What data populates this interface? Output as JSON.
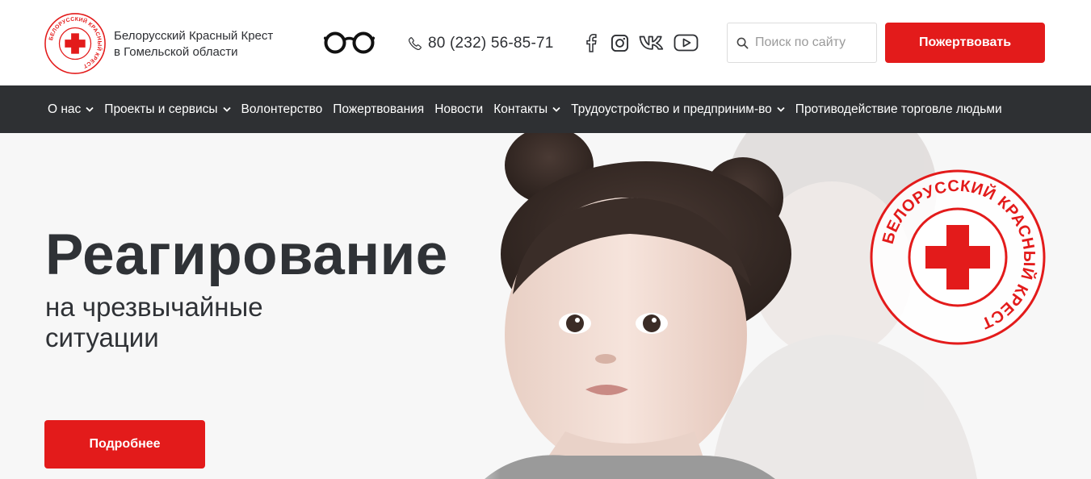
{
  "header": {
    "org_line1": "Белорусский Красный Крест",
    "org_line2": "в Гомельской области",
    "logo_text": "БЕЛОРУССКИЙ КРАСНЫЙ КРЕСТ",
    "phone": "80 (232) 56-85-71",
    "search_placeholder": "Поиск по сайту",
    "donate_label": "Пожертвовать",
    "icons": {
      "logo": "red-cross-logo",
      "accessibility": "glasses-icon",
      "phone": "phone-icon",
      "facebook": "facebook-icon",
      "instagram": "instagram-icon",
      "vk": "vk-icon",
      "youtube": "youtube-icon",
      "search": "search-icon"
    }
  },
  "nav": {
    "items": [
      {
        "label": "О нас",
        "dropdown": true
      },
      {
        "label": "Проекты и сервисы",
        "dropdown": true
      },
      {
        "label": "Волонтерство",
        "dropdown": false
      },
      {
        "label": "Пожертвования",
        "dropdown": false
      },
      {
        "label": "Новости",
        "dropdown": false
      },
      {
        "label": "Контакты",
        "dropdown": true
      },
      {
        "label": "Трудоустройство и предприним-во",
        "dropdown": true
      },
      {
        "label": "Противодействие торговле людьми",
        "dropdown": false
      }
    ]
  },
  "hero": {
    "title": "Реагирование",
    "subtitle_line1": "на чрезвычайные",
    "subtitle_line2": "ситуации",
    "button_label": "Подробнее",
    "emblem_text": "БЕЛОРУССКИЙ КРАСНЫЙ КРЕСТ"
  },
  "colors": {
    "accent_red": "#e31b1b",
    "nav_bg": "#2e3033",
    "text_dark": "#2d2f33"
  }
}
